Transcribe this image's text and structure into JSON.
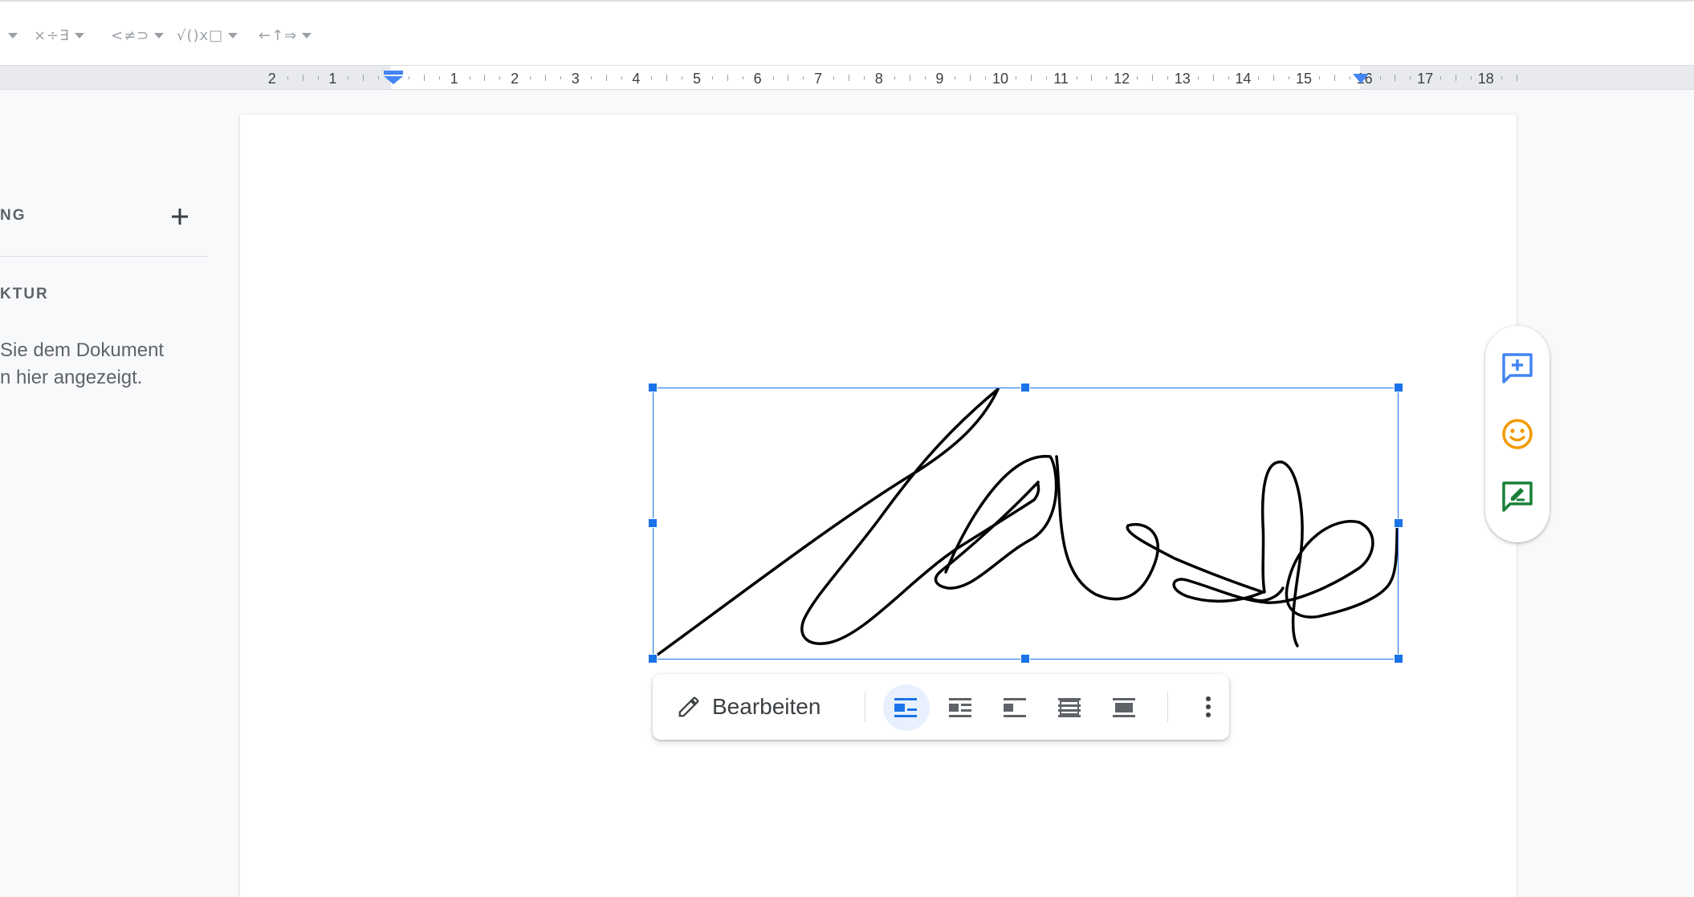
{
  "toolbar": {
    "groups": [
      {
        "name": "relations",
        "symbols": "×÷∃"
      },
      {
        "name": "comparisons",
        "symbols": "<≠⊃"
      },
      {
        "name": "math",
        "symbols": "√()x□"
      },
      {
        "name": "arrows",
        "symbols": "←↑⇒"
      }
    ]
  },
  "ruler": {
    "labels": [
      "2",
      "1",
      "1",
      "2",
      "3",
      "4",
      "5",
      "6",
      "7",
      "8",
      "9",
      "10",
      "11",
      "12",
      "13",
      "14",
      "15",
      "16",
      "17",
      "18"
    ]
  },
  "left_panel": {
    "heading1": "NG",
    "heading2": "KTUR",
    "hint_line1": "Sie dem Dokument",
    "hint_line2": "n hier angezeigt."
  },
  "image_toolbar": {
    "edit_label": "Bearbeiten",
    "wrap_options": [
      "inline",
      "wrap-text",
      "break-text",
      "behind-text",
      "in-front-of-text"
    ],
    "active_wrap": "inline"
  },
  "side_panel": {
    "buttons": [
      "add-comment",
      "add-emoji-reaction",
      "suggest-edits"
    ]
  },
  "colors": {
    "accent": "#1a73e8",
    "comment": "#4285f4",
    "emoji": "#f29900",
    "suggest": "#188038"
  }
}
